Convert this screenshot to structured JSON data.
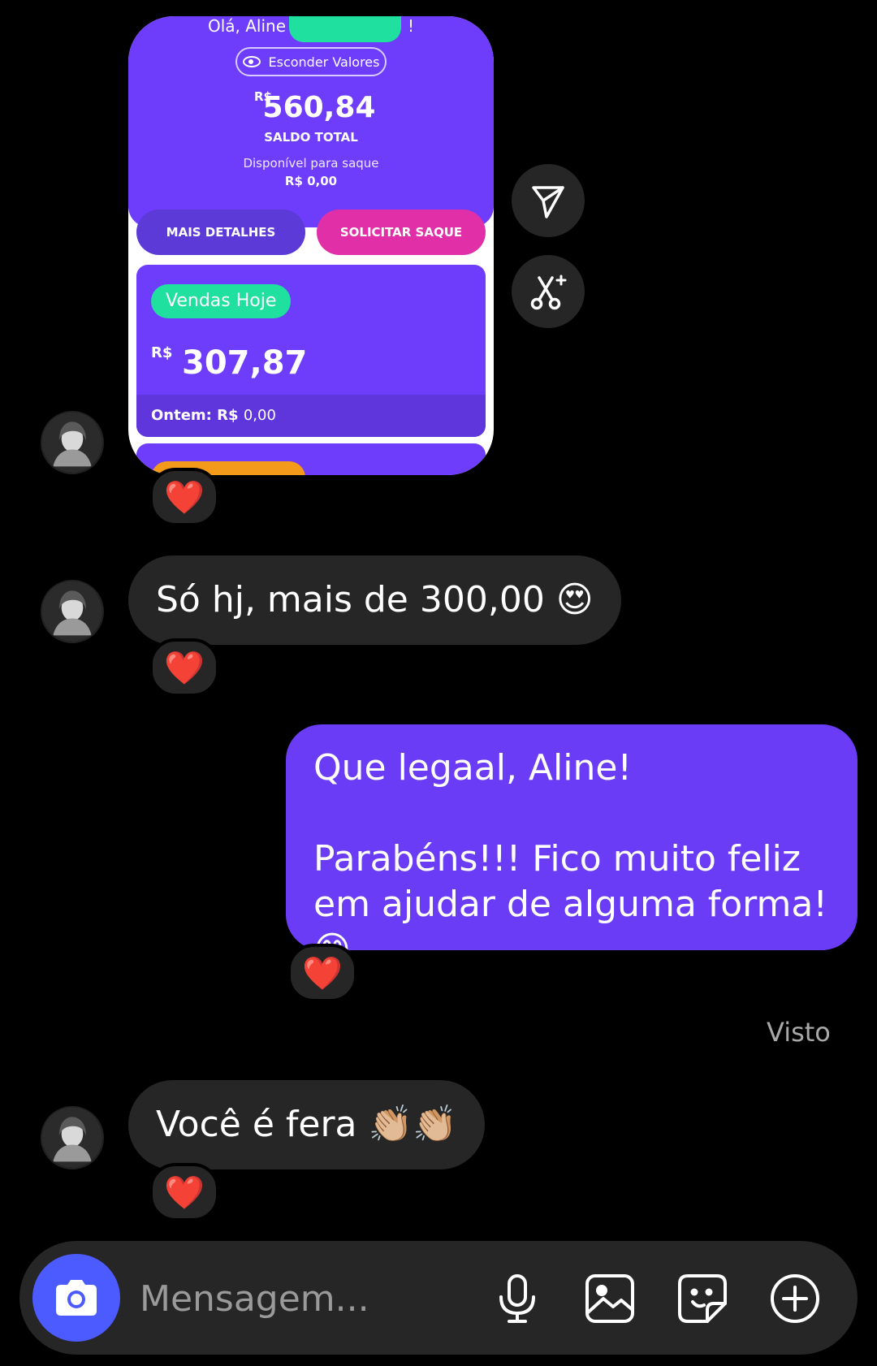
{
  "shared_image": {
    "greeting": "Olá, Aline",
    "greeting_end": "!",
    "hide_values": "Esconder Valores",
    "balance_currency": "R$",
    "balance_value": "560,84",
    "balance_label": "SALDO TOTAL",
    "available_label": "Disponível para saque",
    "available_value": "R$ 0,00",
    "details_button": "MAIS DETALHES",
    "withdraw_button": "SOLICITAR SAQUE",
    "sales_badge": "Vendas Hoje",
    "sales_currency": "R$",
    "sales_value": "307,87",
    "yesterday_label": "Ontem: R$",
    "yesterday_value": "0,00"
  },
  "messages": [
    {
      "side": "in",
      "text": "Só hj, mais de 300,00 😍",
      "reaction": "❤️"
    },
    {
      "side": "out",
      "line1": "Que legaal, Aline!",
      "line2": "Parabéns!!! Fico muito feliz em ajudar de alguma forma! 😊",
      "reaction": "❤️"
    },
    {
      "side": "in",
      "text": "Você é fera 👏🏼👏🏼",
      "reaction": "❤️"
    }
  ],
  "image_reaction": "❤️",
  "seen_label": "Visto",
  "composer": {
    "placeholder": "Mensagem..."
  },
  "icons": {
    "share": "paper-plane-icon",
    "ai_edit": "scissors-sparkle-icon",
    "camera": "camera-icon",
    "mic": "microphone-icon",
    "gallery": "image-icon",
    "sticker": "sticker-icon",
    "plus": "plus-circle-icon"
  },
  "colors": {
    "accent": "#6e3cfb",
    "outgoing_bubble": "#6b3cf6",
    "incoming_bubble": "#262626",
    "mint": "#1fe09e",
    "pink": "#e12fa7",
    "camera": "#4c5bff"
  }
}
